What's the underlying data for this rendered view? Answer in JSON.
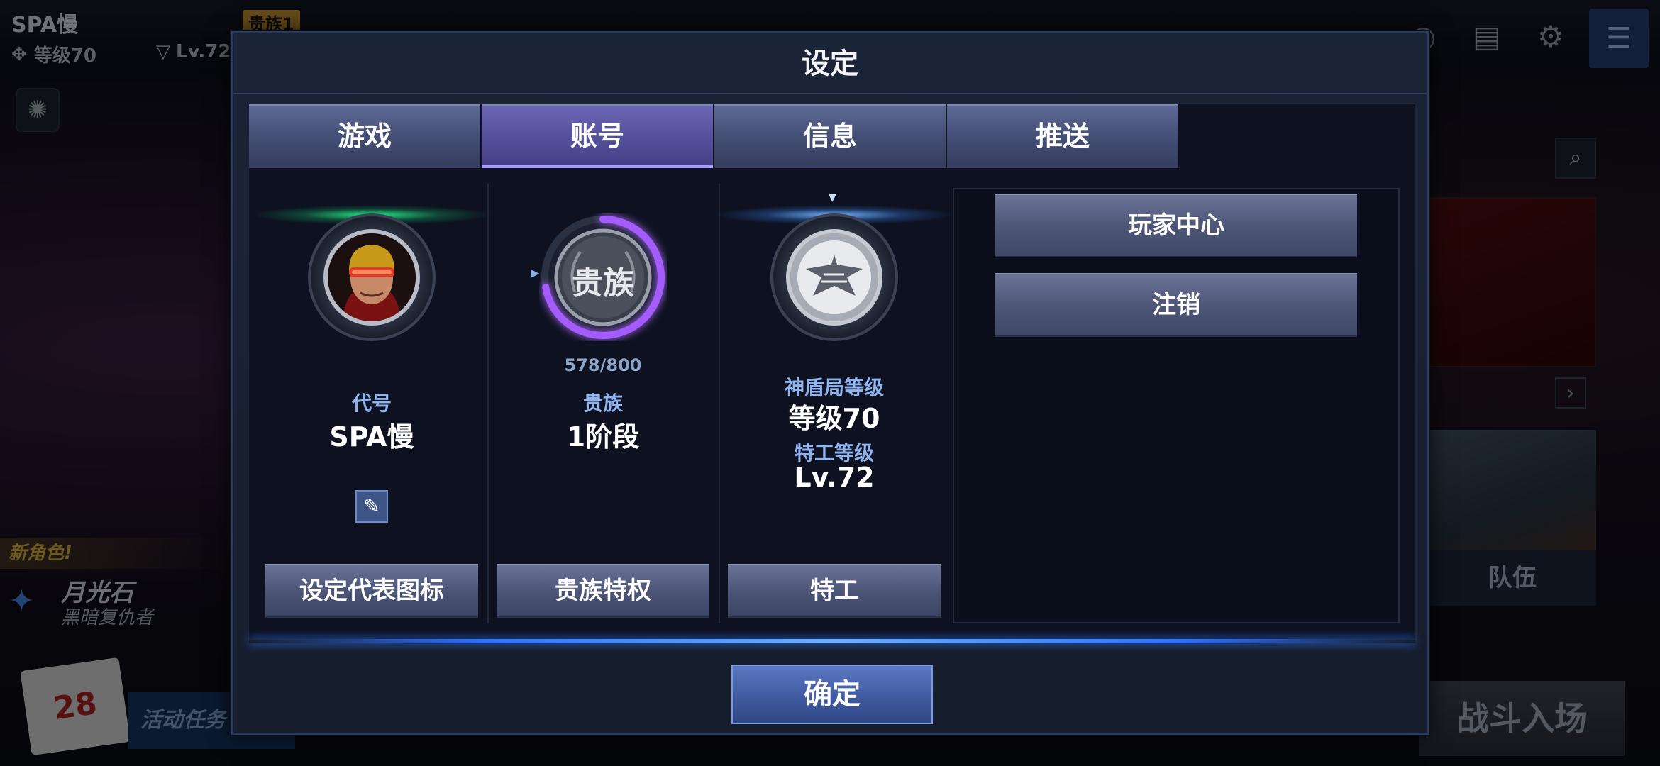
{
  "background": {
    "player_name": "SPA慢",
    "vip_badge": "贵族1",
    "shield_level": "等级70",
    "agent_level": "Lv.72",
    "new_character_banner": "新角色!",
    "new_character_name": "月光石",
    "new_character_team": "黑暗复仇者",
    "calendar_day": "28",
    "event_label": "活动任务",
    "team_label": "队伍",
    "battle_label": "战斗入场"
  },
  "dialog": {
    "title": "设定",
    "tabs": [
      {
        "label": "游戏",
        "active": false
      },
      {
        "label": "账号",
        "active": true
      },
      {
        "label": "信息",
        "active": false
      },
      {
        "label": "推送",
        "active": false
      }
    ],
    "codename": {
      "label": "代号",
      "value": "SPA慢",
      "button": "设定代表图标"
    },
    "nobility": {
      "badge_text": "贵族",
      "progress": "578/800",
      "progress_fraction": 0.7225,
      "label": "贵族",
      "value": "1阶段",
      "button": "贵族特权"
    },
    "shield": {
      "shield_label": "神盾局等级",
      "shield_value": "等级70",
      "agent_label": "特工等级",
      "agent_value": "Lv.72",
      "button": "特工"
    },
    "right_buttons": {
      "player_center": "玩家中心",
      "logout": "注销"
    },
    "confirm": "确定"
  },
  "colors": {
    "tab_active": "#54509a",
    "tab_inactive": "#434c72",
    "label_blue": "#8fb5f0",
    "confirm_blue": "#3f5aa0",
    "nobility_purple": "#a45cff",
    "green_glow": "#19e37a",
    "blue_glow": "#3c8bff"
  }
}
